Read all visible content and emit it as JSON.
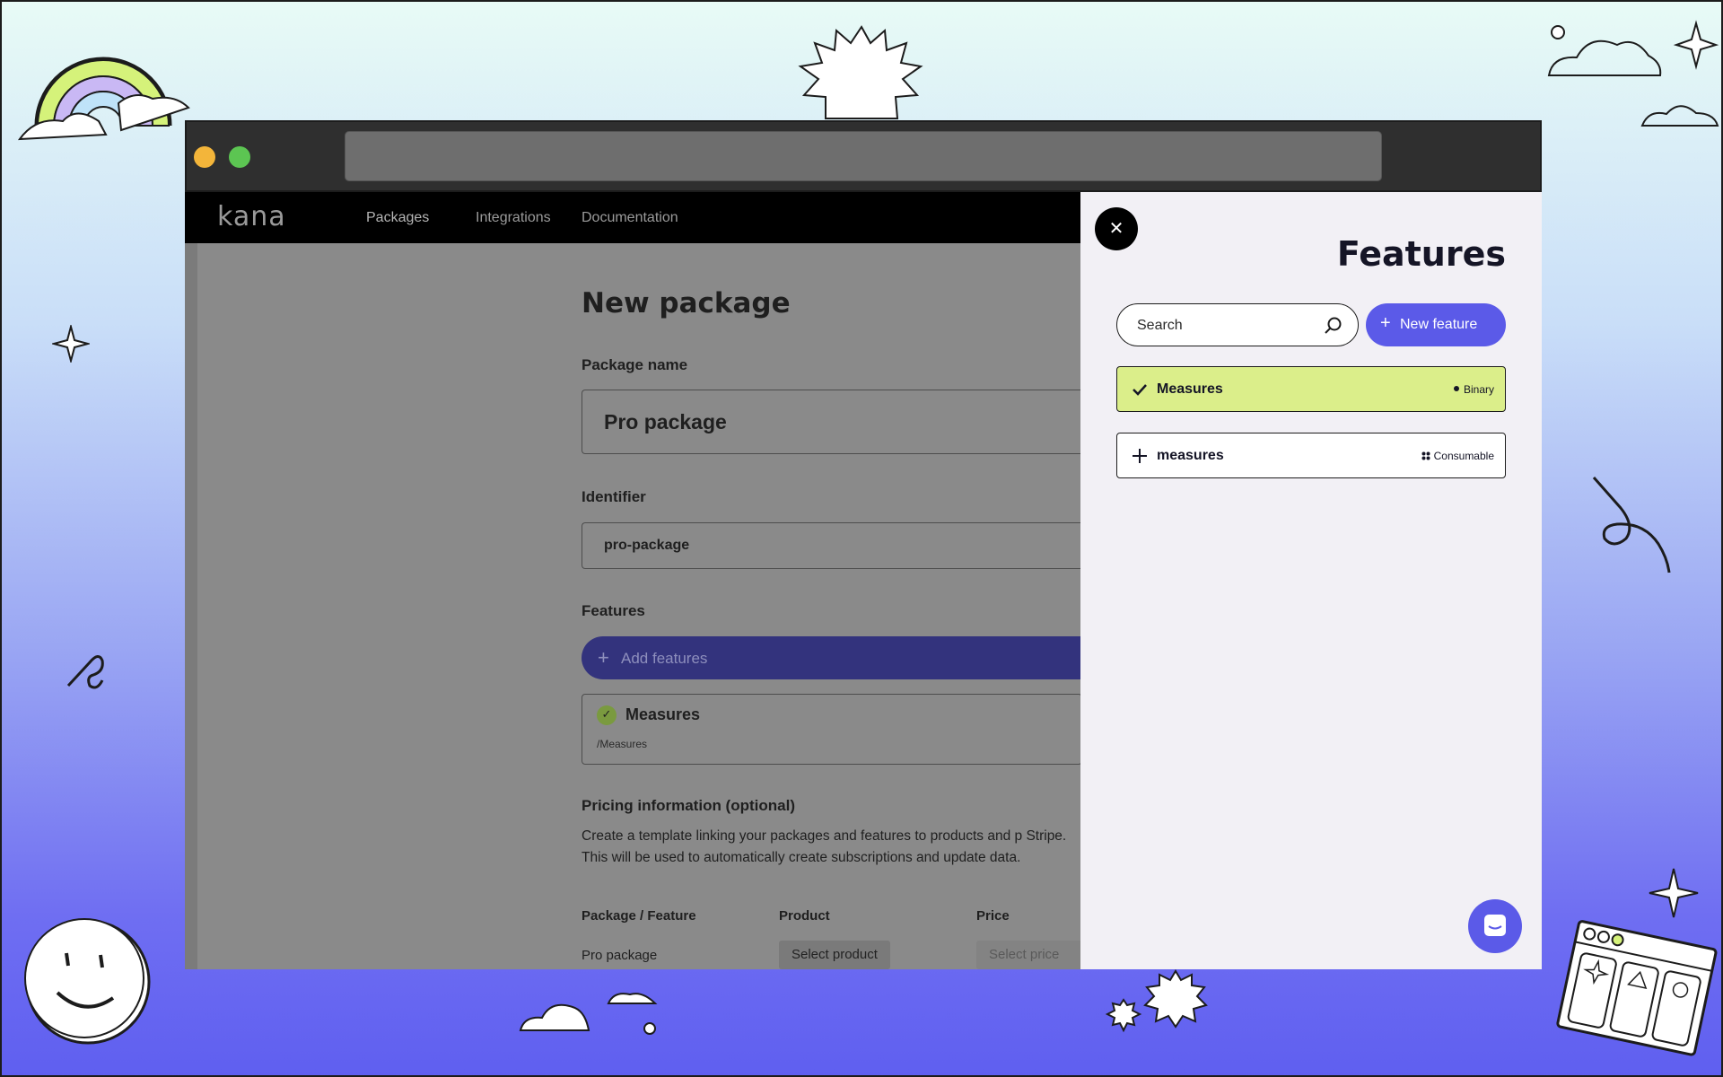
{
  "nav": {
    "logo": "kana",
    "links": [
      "Packages",
      "Integrations",
      "Documentation"
    ]
  },
  "form": {
    "title": "New package",
    "package_name_label": "Package name",
    "package_name_value": "Pro package",
    "identifier_label": "Identifier",
    "identifier_value": "pro-package",
    "features_label": "Features",
    "add_features": "Add features",
    "feature_card": {
      "name": "Measures",
      "path": "/Measures"
    },
    "pricing_label": "Pricing information (optional)",
    "pricing_text": "Create a template linking your packages and features to products and p Stripe. This will be used to automatically create subscriptions and update data.",
    "columns": [
      "Package / Feature",
      "Product",
      "Price"
    ],
    "row": {
      "name": "Pro package",
      "product": "Select product",
      "price": "Select price"
    }
  },
  "panel": {
    "title": "Features",
    "search_placeholder": "Search",
    "new_feature": "New feature",
    "items": [
      {
        "label": "Measures",
        "type": "Binary",
        "selected": true
      },
      {
        "label": "measures",
        "type": "Consumable",
        "selected": false
      }
    ]
  },
  "colors": {
    "accent": "#5b5ae8",
    "selected": "#dbee8a",
    "nav": "#000000"
  }
}
